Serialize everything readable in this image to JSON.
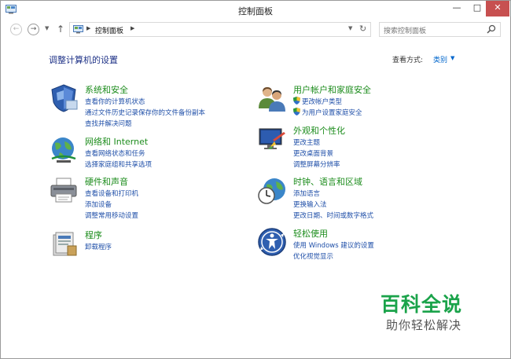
{
  "window": {
    "title": "控制面板",
    "buttons": {
      "minimize": "—",
      "maximize": "□",
      "close": "✕"
    }
  },
  "nav": {
    "back_icon": "back-arrow-icon",
    "forward_icon": "forward-arrow-icon",
    "up_icon": "up-arrow-icon",
    "address": "控制面板",
    "search_placeholder": "搜索控制面板"
  },
  "page": {
    "title": "调整计算机的设置",
    "view_by_label": "查看方式:",
    "view_by_value": "类别"
  },
  "categories_left": [
    {
      "title": "系统和安全",
      "icon": "shield-icon",
      "links": [
        "查看你的计算机状态",
        "通过文件历史记录保存你的文件备份副本",
        "查找并解决问题"
      ]
    },
    {
      "title": "网络和 Internet",
      "icon": "network-globe-icon",
      "links": [
        "查看网络状态和任务",
        "选择家庭组和共享选项"
      ]
    },
    {
      "title": "硬件和声音",
      "icon": "printer-icon",
      "links": [
        "查看设备和打印机",
        "添加设备",
        "调整常用移动设置"
      ]
    },
    {
      "title": "程序",
      "icon": "programs-icon",
      "links": [
        "卸载程序"
      ]
    }
  ],
  "categories_right": [
    {
      "title": "用户帐户和家庭安全",
      "icon": "users-icon",
      "links": [
        "更改帐户类型",
        "为用户设置家庭安全"
      ]
    },
    {
      "title": "外观和个性化",
      "icon": "appearance-icon",
      "links": [
        "更改主题",
        "更改桌面背景",
        "调整屏幕分辨率"
      ]
    },
    {
      "title": "时钟、语言和区域",
      "icon": "clock-globe-icon",
      "links": [
        "添加语言",
        "更换输入法",
        "更改日期、时间或数字格式"
      ]
    },
    {
      "title": "轻松使用",
      "icon": "ease-of-access-icon",
      "links": [
        "使用 Windows 建议的设置",
        "优化视觉显示"
      ]
    }
  ],
  "watermark": {
    "title": "百科全说",
    "subtitle": "助你轻松解决"
  }
}
